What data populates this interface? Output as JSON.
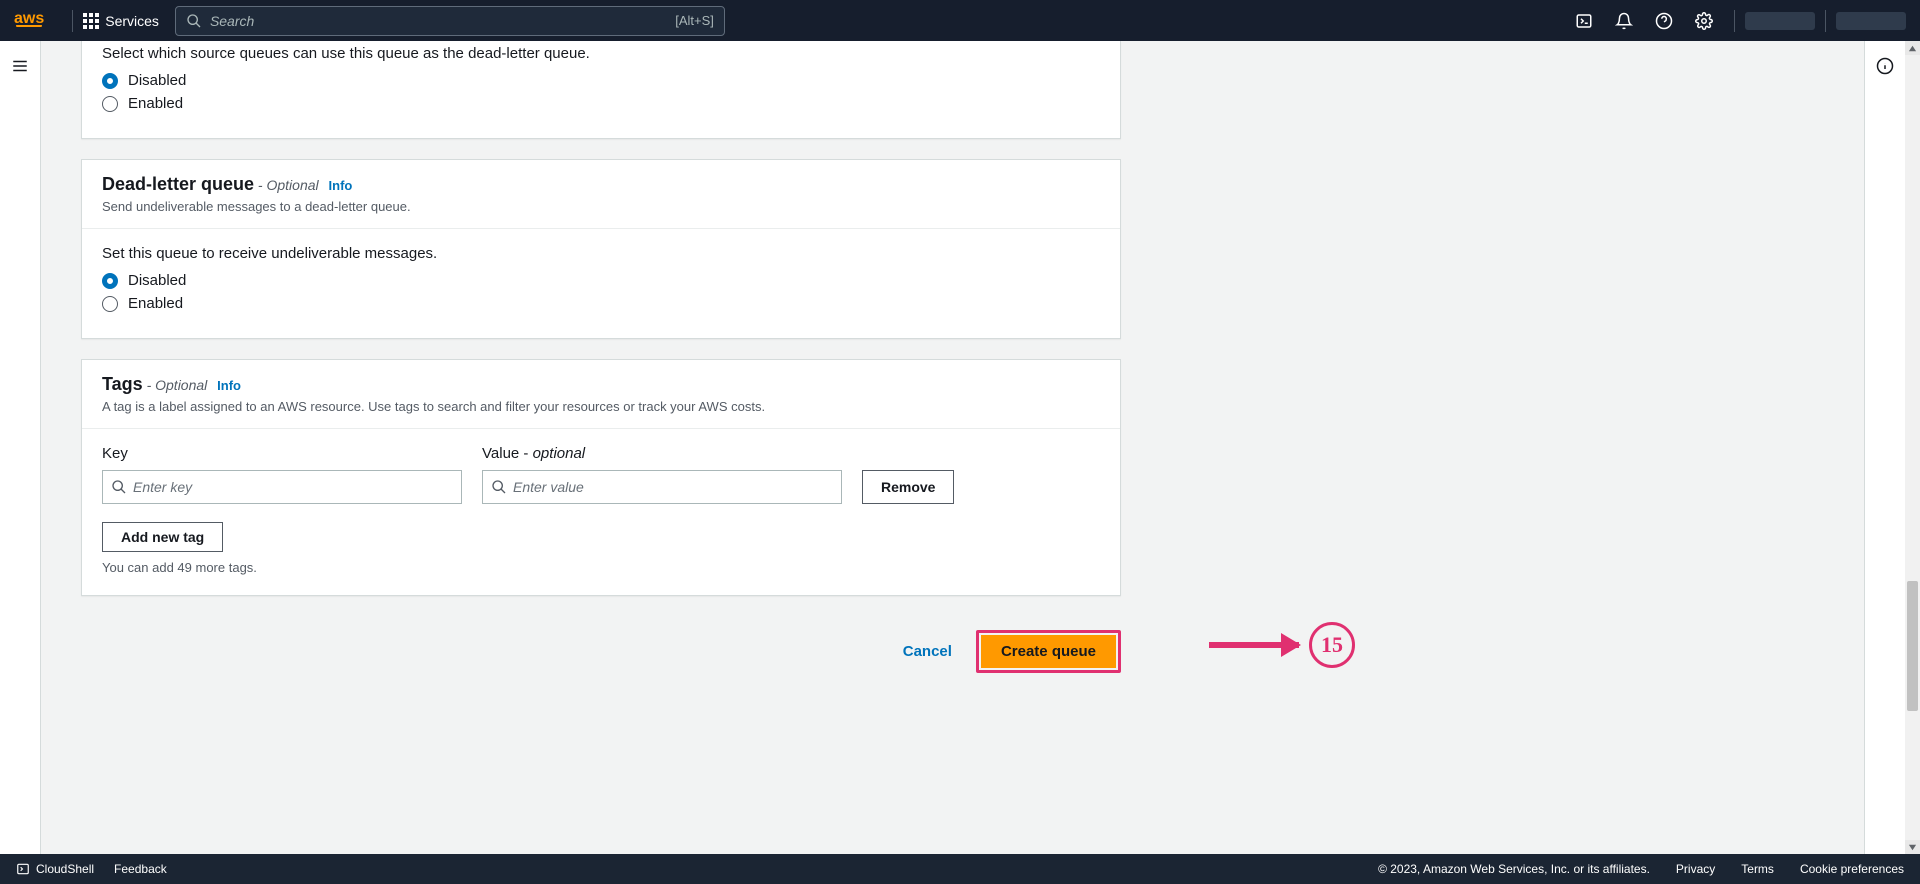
{
  "nav": {
    "logo_text": "aws",
    "services_label": "Services",
    "search_placeholder": "Search",
    "search_hint": "[Alt+S]"
  },
  "redrive": {
    "field_label": "Select which source queues can use this queue as the dead-letter queue.",
    "options": {
      "disabled": "Disabled",
      "enabled": "Enabled"
    }
  },
  "dlq": {
    "title": "Dead-letter queue",
    "optional": " - Optional",
    "info": "Info",
    "sub": "Send undeliverable messages to a dead-letter queue.",
    "field_label": "Set this queue to receive undeliverable messages.",
    "options": {
      "disabled": "Disabled",
      "enabled": "Enabled"
    }
  },
  "tags": {
    "title": "Tags",
    "optional": " - Optional",
    "info": "Info",
    "sub": "A tag is a label assigned to an AWS resource. Use tags to search and filter your resources or track your AWS costs.",
    "key_label": "Key",
    "value_label": "Value - ",
    "value_optional": "optional",
    "key_placeholder": "Enter key",
    "value_placeholder": "Enter value",
    "remove_label": "Remove",
    "add_label": "Add new tag",
    "hint": "You can add 49 more tags."
  },
  "actions": {
    "cancel": "Cancel",
    "create": "Create queue",
    "annotation_number": "15"
  },
  "footer": {
    "cloudshell": "CloudShell",
    "feedback": "Feedback",
    "copyright": "© 2023, Amazon Web Services, Inc. or its affiliates.",
    "privacy": "Privacy",
    "terms": "Terms",
    "cookie": "Cookie preferences"
  }
}
